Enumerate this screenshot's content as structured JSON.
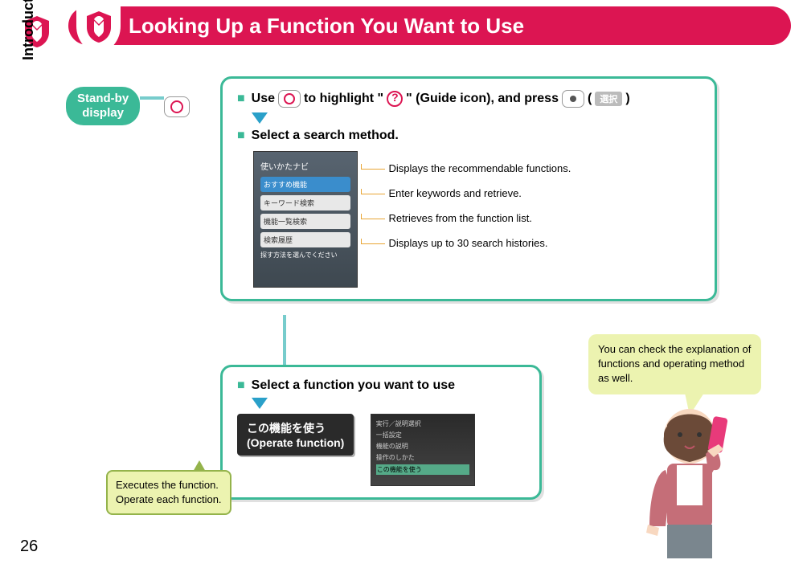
{
  "page_number": "26",
  "side_label": "Introduction",
  "header": {
    "title": "Looking Up a Function You Want to Use"
  },
  "standby": {
    "label_l1": "Stand-by",
    "label_l2": "display"
  },
  "step1": {
    "pre": "Use",
    "mid1": "to highlight \"",
    "mid2": "\" (Guide icon), and press",
    "tail_open": "(",
    "select_label": "選択",
    "tail_close": ")"
  },
  "step2": {
    "text": "Select a search method."
  },
  "menu": {
    "title": "使いかたナビ",
    "item1": "おすすめ機能",
    "item2": "キーワード検索",
    "item3": "機能一覧検索",
    "item4": "検索履歴",
    "hint": "探す方法を選んでください"
  },
  "method_labels": {
    "a": "Displays the recommendable functions.",
    "b": "Enter keywords and retrieve.",
    "c": "Retrieves from the function list.",
    "d": "Displays up to 30 search histories."
  },
  "step3": {
    "text": "Select a function you want to use"
  },
  "operate": {
    "jp": "この機能を使う",
    "en": "(Operate function)"
  },
  "mini": {
    "r1": "実行／説明選択",
    "r2": "一括設定",
    "r3": "機能の説明",
    "r4": "操作のしかた",
    "r5": "この機能を使う"
  },
  "callout_exec": {
    "l1": "Executes the function.",
    "l2": "Operate each function."
  },
  "speech": {
    "text": "You can check the explanation of functions and operating method as well."
  }
}
